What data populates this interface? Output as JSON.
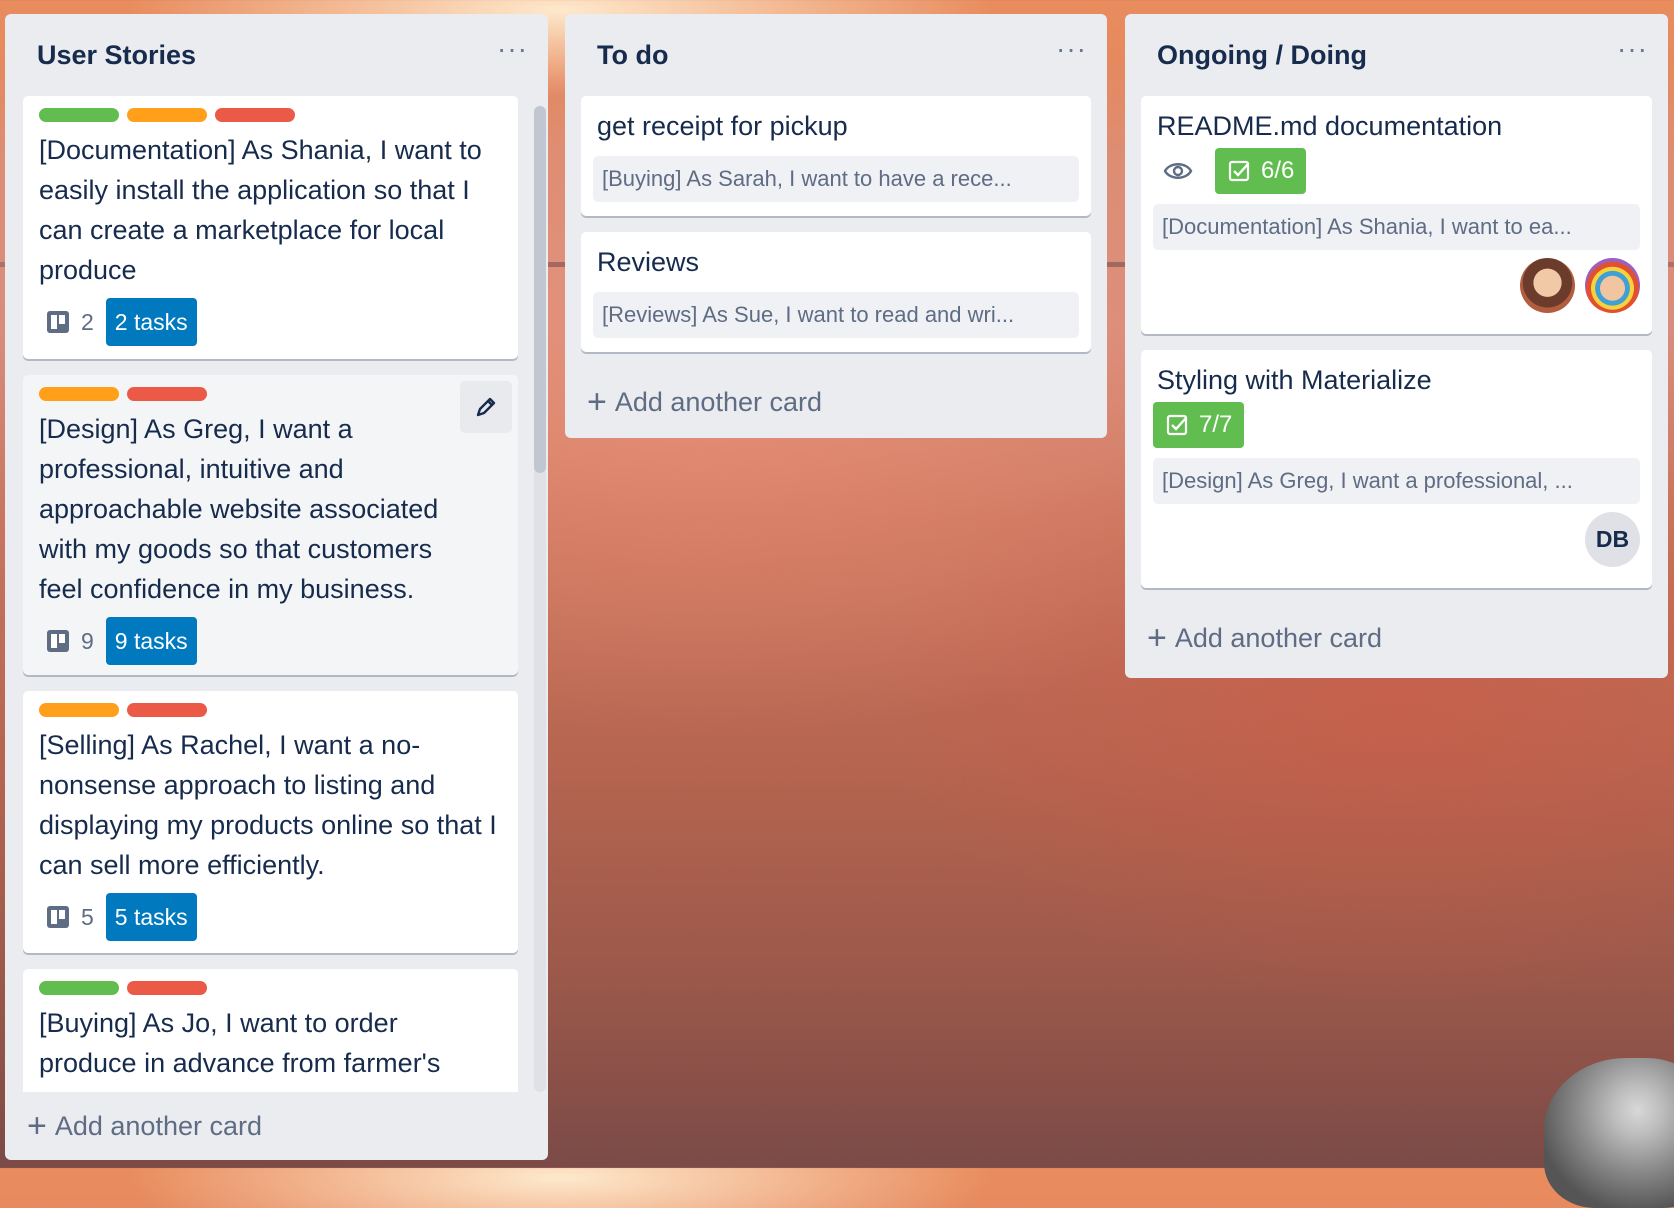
{
  "colors": {
    "list_bg": "#ebecf0",
    "card_bg": "#ffffff",
    "label_green": "#61bd4f",
    "label_orange": "#ff9f1a",
    "label_red": "#eb5a46",
    "task_badge": "#0079bf",
    "checklist_complete": "#61bd4f"
  },
  "lists": [
    {
      "title": "User Stories",
      "menu": "···",
      "add_card": "Add another card",
      "cards": [
        {
          "labels": [
            "green",
            "orange",
            "red"
          ],
          "title": "[Documentation] As Shania, I want to easily install the application so that I can create a marketplace for local produce",
          "count": "2",
          "tasks": "2 tasks"
        },
        {
          "labels": [
            "orange",
            "red"
          ],
          "title": "[Design] As Greg, I want a professional, intuitive and approachable website associated with my goods so that customers feel confidence in my business.",
          "count": "9",
          "tasks": "9 tasks"
        },
        {
          "labels": [
            "orange",
            "red"
          ],
          "title": "[Selling] As Rachel, I want a no-nonsense approach to listing and displaying my products online so that I can sell more efficiently.",
          "count": "5",
          "tasks": "5 tasks"
        },
        {
          "labels": [
            "green",
            "red"
          ],
          "title": "[Buying] As Jo, I want to order produce in advance from farmer's"
        }
      ]
    },
    {
      "title": "To do",
      "menu": "···",
      "add_card": "Add another card",
      "cards": [
        {
          "title": "get receipt for pickup",
          "attachment": "[Buying] As Sarah, I want to have a rece..."
        },
        {
          "title": "Reviews",
          "attachment": "[Reviews] As Sue, I want to read and wri..."
        }
      ]
    },
    {
      "title": "Ongoing / Doing",
      "menu": "···",
      "add_card": "Add another card",
      "cards": [
        {
          "title": "README.md documentation",
          "checklist": "6/6",
          "attachment": "[Documentation] As Shania, I want to ea...",
          "watch_icon": "eye-icon",
          "members": [
            "avatar-photo",
            "avatar-photo"
          ]
        },
        {
          "title": "Styling with Materialize",
          "checklist": "7/7",
          "attachment": "[Design] As Greg, I want a professional, ...",
          "member_initials": "DB"
        }
      ]
    }
  ]
}
